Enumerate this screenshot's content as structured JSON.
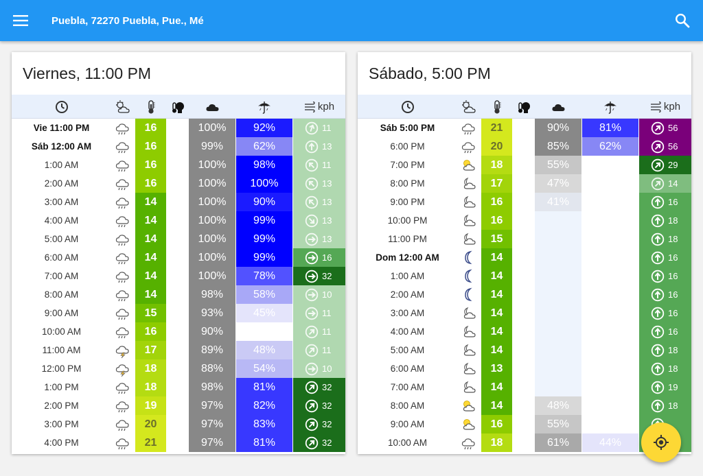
{
  "app": {
    "location": "Puebla, 72270 Puebla, Pue., Mé",
    "icons": {
      "menu": "menu-icon",
      "search": "search-icon",
      "locate": "my-location-icon"
    },
    "colors": {
      "appbar": "#2196f3",
      "fab": "#fdd835"
    }
  },
  "header": {
    "columns": [
      "time-icon",
      "conditions-icon",
      "temperature-icon",
      "feels-like-icon",
      "cloud-cover-icon",
      "precipitation-icon",
      "wind-icon"
    ],
    "wind_unit": "kph"
  },
  "cards": [
    {
      "title": "Viernes, 11:00 PM",
      "rows": [
        {
          "time": "Vie 11:00 PM",
          "bold": true,
          "cond": "rain",
          "temp": "16",
          "cloud": "100%",
          "precip": "92%",
          "wind": "11",
          "dir": 200
        },
        {
          "time": "Sáb 12:00 AM",
          "bold": true,
          "cond": "rain",
          "temp": "16",
          "cloud": "99%",
          "precip": "62%",
          "wind": "13",
          "dir": 180
        },
        {
          "time": "1:00 AM",
          "bold": false,
          "cond": "rain",
          "temp": "16",
          "cloud": "100%",
          "precip": "98%",
          "wind": "11",
          "dir": 135
        },
        {
          "time": "2:00 AM",
          "bold": false,
          "cond": "rain",
          "temp": "16",
          "cloud": "100%",
          "precip": "100%",
          "wind": "13",
          "dir": 135
        },
        {
          "time": "3:00 AM",
          "bold": false,
          "cond": "rain",
          "temp": "14",
          "cloud": "100%",
          "precip": "90%",
          "wind": "13",
          "dir": 135
        },
        {
          "time": "4:00 AM",
          "bold": false,
          "cond": "rain",
          "temp": "14",
          "cloud": "100%",
          "precip": "99%",
          "wind": "13",
          "dir": 315
        },
        {
          "time": "5:00 AM",
          "bold": false,
          "cond": "rain",
          "temp": "14",
          "cloud": "100%",
          "precip": "99%",
          "wind": "13",
          "dir": 270
        },
        {
          "time": "6:00 AM",
          "bold": false,
          "cond": "rain",
          "temp": "14",
          "cloud": "100%",
          "precip": "99%",
          "wind": "16",
          "dir": 270
        },
        {
          "time": "7:00 AM",
          "bold": false,
          "cond": "rain",
          "temp": "14",
          "cloud": "100%",
          "precip": "78%",
          "wind": "32",
          "dir": 270
        },
        {
          "time": "8:00 AM",
          "bold": false,
          "cond": "rain",
          "temp": "14",
          "cloud": "98%",
          "precip": "58%",
          "wind": "10",
          "dir": 270
        },
        {
          "time": "9:00 AM",
          "bold": false,
          "cond": "rain",
          "temp": "15",
          "cloud": "93%",
          "precip": "45%",
          "wind": "11",
          "dir": 270
        },
        {
          "time": "10:00 AM",
          "bold": false,
          "cond": "rain",
          "temp": "16",
          "cloud": "90%",
          "precip": "",
          "wind": "11",
          "dir": 225
        },
        {
          "time": "11:00 AM",
          "bold": false,
          "cond": "thunder",
          "temp": "17",
          "cloud": "89%",
          "precip": "48%",
          "wind": "11",
          "dir": 225
        },
        {
          "time": "12:00 PM",
          "bold": false,
          "cond": "thunder",
          "temp": "18",
          "cloud": "88%",
          "precip": "54%",
          "wind": "10",
          "dir": 270
        },
        {
          "time": "1:00 PM",
          "bold": false,
          "cond": "rain",
          "temp": "18",
          "cloud": "98%",
          "precip": "81%",
          "wind": "32",
          "dir": 225
        },
        {
          "time": "2:00 PM",
          "bold": false,
          "cond": "rain",
          "temp": "19",
          "cloud": "97%",
          "precip": "82%",
          "wind": "32",
          "dir": 225
        },
        {
          "time": "3:00 PM",
          "bold": false,
          "cond": "rain",
          "temp": "20",
          "cloud": "97%",
          "precip": "83%",
          "wind": "32",
          "dir": 225
        },
        {
          "time": "4:00 PM",
          "bold": false,
          "cond": "rain",
          "temp": "21",
          "cloud": "97%",
          "precip": "81%",
          "wind": "32",
          "dir": 225
        }
      ]
    },
    {
      "title": "Sábado, 5:00 PM",
      "rows": [
        {
          "time": "Sáb 5:00 PM",
          "bold": true,
          "cond": "rain",
          "temp": "21",
          "cloud": "90%",
          "precip": "81%",
          "wind": "56",
          "dir": 225
        },
        {
          "time": "6:00 PM",
          "bold": false,
          "cond": "rain",
          "temp": "20",
          "cloud": "85%",
          "precip": "62%",
          "wind": "56",
          "dir": 225
        },
        {
          "time": "7:00 PM",
          "bold": false,
          "cond": "partly-sunny",
          "temp": "18",
          "cloud": "55%",
          "precip": "",
          "wind": "29",
          "dir": 225
        },
        {
          "time": "8:00 PM",
          "bold": false,
          "cond": "night-cloudy",
          "temp": "17",
          "cloud": "47%",
          "precip": "",
          "wind": "14",
          "dir": 225
        },
        {
          "time": "9:00 PM",
          "bold": false,
          "cond": "night-cloudy",
          "temp": "16",
          "cloud": "41%",
          "precip": "",
          "wind": "16",
          "dir": 180
        },
        {
          "time": "10:00 PM",
          "bold": false,
          "cond": "night-cloudy",
          "temp": "16",
          "cloud": "",
          "precip": "",
          "wind": "18",
          "dir": 180
        },
        {
          "time": "11:00 PM",
          "bold": false,
          "cond": "night-cloudy",
          "temp": "15",
          "cloud": "",
          "precip": "",
          "wind": "18",
          "dir": 180
        },
        {
          "time": "Dom 12:00 AM",
          "bold": true,
          "cond": "moon",
          "temp": "14",
          "cloud": "",
          "precip": "",
          "wind": "16",
          "dir": 180
        },
        {
          "time": "1:00 AM",
          "bold": false,
          "cond": "moon",
          "temp": "14",
          "cloud": "",
          "precip": "",
          "wind": "16",
          "dir": 180
        },
        {
          "time": "2:00 AM",
          "bold": false,
          "cond": "moon",
          "temp": "14",
          "cloud": "",
          "precip": "",
          "wind": "16",
          "dir": 180
        },
        {
          "time": "3:00 AM",
          "bold": false,
          "cond": "night-cloudy",
          "temp": "14",
          "cloud": "",
          "precip": "",
          "wind": "16",
          "dir": 180
        },
        {
          "time": "4:00 AM",
          "bold": false,
          "cond": "night-cloudy",
          "temp": "14",
          "cloud": "",
          "precip": "",
          "wind": "16",
          "dir": 180
        },
        {
          "time": "5:00 AM",
          "bold": false,
          "cond": "night-cloudy",
          "temp": "14",
          "cloud": "",
          "precip": "",
          "wind": "18",
          "dir": 180
        },
        {
          "time": "6:00 AM",
          "bold": false,
          "cond": "night-cloudy",
          "temp": "13",
          "cloud": "",
          "precip": "",
          "wind": "18",
          "dir": 180
        },
        {
          "time": "7:00 AM",
          "bold": false,
          "cond": "night-cloudy",
          "temp": "14",
          "cloud": "",
          "precip": "",
          "wind": "19",
          "dir": 180
        },
        {
          "time": "8:00 AM",
          "bold": false,
          "cond": "partly-sunny",
          "temp": "14",
          "cloud": "48%",
          "precip": "",
          "wind": "18",
          "dir": 180
        },
        {
          "time": "9:00 AM",
          "bold": false,
          "cond": "partly-sunny",
          "temp": "16",
          "cloud": "55%",
          "precip": "",
          "wind": "",
          "dir": 180
        },
        {
          "time": "10:00 AM",
          "bold": false,
          "cond": "rain",
          "temp": "18",
          "cloud": "61%",
          "precip": "44%",
          "wind": "",
          "dir": 180
        }
      ]
    }
  ]
}
